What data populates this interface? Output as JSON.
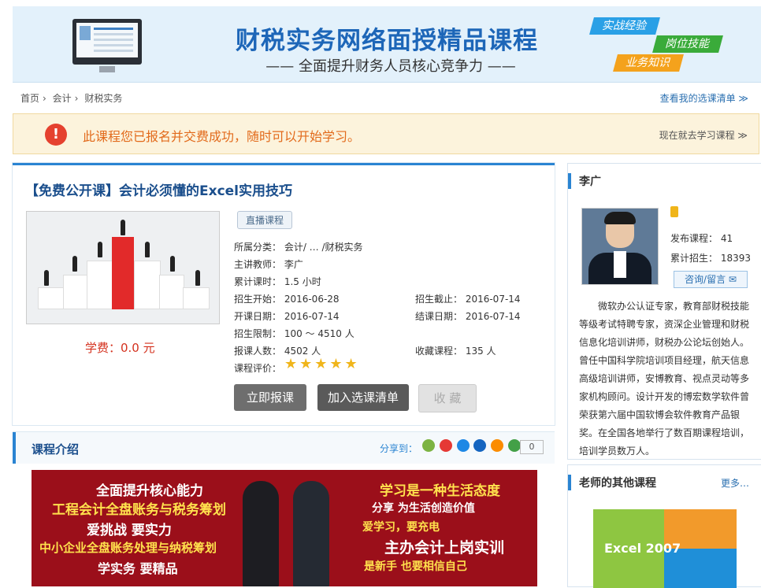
{
  "banner": {
    "title": "财税实务网络面授精品课程",
    "subtitle": "—— 全面提升财务人员核心竞争力 ——",
    "tags": [
      "实战经验",
      "岗位技能",
      "业务知识"
    ]
  },
  "breadcrumb": {
    "items": [
      "首页",
      "会计",
      "财税实务"
    ],
    "right_link": "查看我的选课清单 ≫"
  },
  "notice": {
    "message": "此课程您已报名并交费成功，随时可以开始学习。",
    "link": "现在就去学习课程 ≫"
  },
  "course": {
    "title": "【免费公开课】会计必须懂的Excel实用技巧",
    "badge": "直播课程",
    "fee": "学费：0.0 元",
    "category": "所属分类：   会计/ … /财税实务",
    "teacher": "主讲教师：   李广",
    "duration": "累计课时：   1.5 小时",
    "enroll_start": "招生开始：   2016-06-28",
    "enroll_end": "招生截止：   2016-07-14",
    "class_start": "开课日期：   2016-07-14",
    "class_end": "结课日期：   2016-07-14",
    "limit": "招生限制：   100 ～ 4510 人",
    "signed": "报课人数：   4502 人",
    "favorites": "收藏课程：   135 人",
    "rating_label": "课程评价：",
    "rating": 5,
    "buttons": {
      "enroll": "立即报课",
      "add_list": "加入选课清单",
      "favorite": "收 藏"
    }
  },
  "intro": {
    "heading": "课程介绍",
    "share_label": "分享到：",
    "share_count": "0",
    "promo": {
      "l1": "全面提升核心能力",
      "l2": "工程会计全盘账务与税务筹划",
      "l3": "爱挑战 要实力",
      "l4": "中小企业全盘账务处理与纳税筹划",
      "l5": "学实务 要精品",
      "r1": "学习是一种生活态度",
      "r2": "分享 为生活创造价值",
      "r3": "爱学习，要充电",
      "r4": "主办会计上岗实训",
      "r5": "是新手 也要相信自己"
    }
  },
  "teacher": {
    "name": "李广",
    "courses": "发布课程：  41",
    "students": "累计招生：  18393",
    "message_btn": "咨询/留言 ✉",
    "bio": "微软办公认证专家，教育部财税技能等级考试特聘专家，资深企业管理和财税信息化培训讲师，财税办公论坛创始人。曾任中国科学院培训项目经理，航天信息高级培训讲师，安博教育、视点灵动等多家机构顾问。设计开发的博宏数学软件曾荣获第六届中国软博会软件教育产品银奖。在全国各地举行了数百期课程培训，培训学员数万人。"
  },
  "other_courses": {
    "heading": "老师的其他课程",
    "more": "更多…",
    "thumb_label": "Excel 2007"
  },
  "colors": {
    "accent": "#2a84d2",
    "alert": "#e5412f",
    "fee": "#d4311e"
  }
}
